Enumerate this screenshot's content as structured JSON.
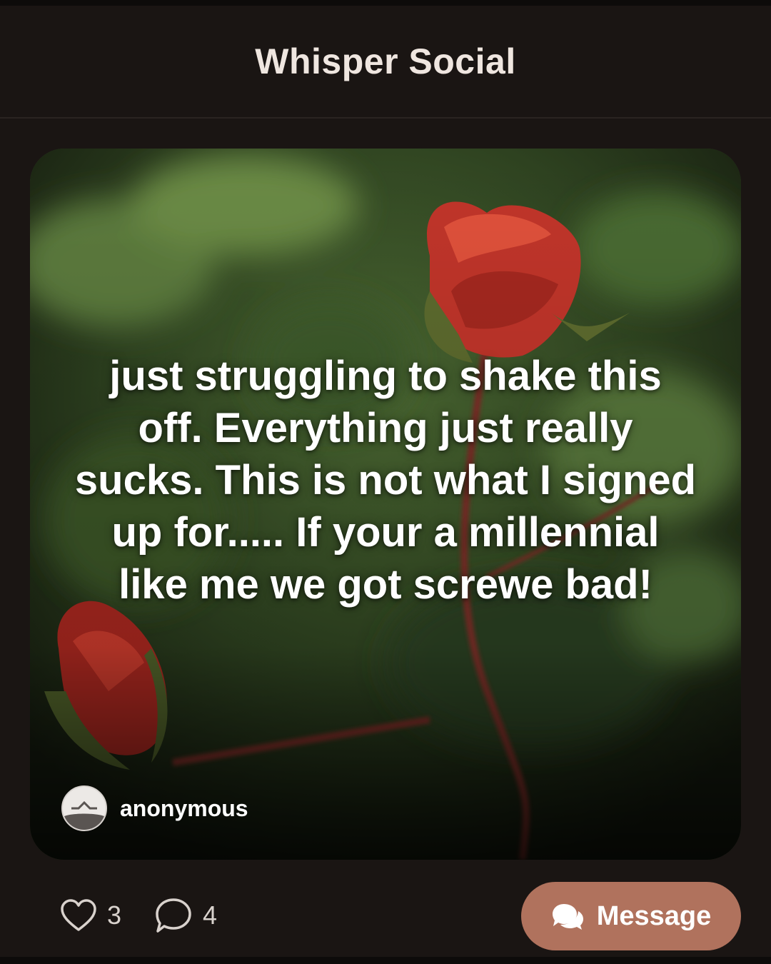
{
  "app": {
    "title": "Whisper Social"
  },
  "post": {
    "text": "just struggling to shake this off. Everything just really sucks. This is not what I signed up for..... If your a millennial like me we got screwe bad!",
    "author": "anonymous",
    "background_description_icon": "rose-image",
    "likes": "3",
    "comments": "4"
  },
  "actions": {
    "message_label": "Message",
    "like_icon": "heart-icon",
    "comment_icon": "speech-bubble-icon",
    "message_icon": "chat-bubbles-icon"
  },
  "colors": {
    "background": "#1a1513",
    "accent": "#b0725d",
    "text": "#efe6e0"
  }
}
